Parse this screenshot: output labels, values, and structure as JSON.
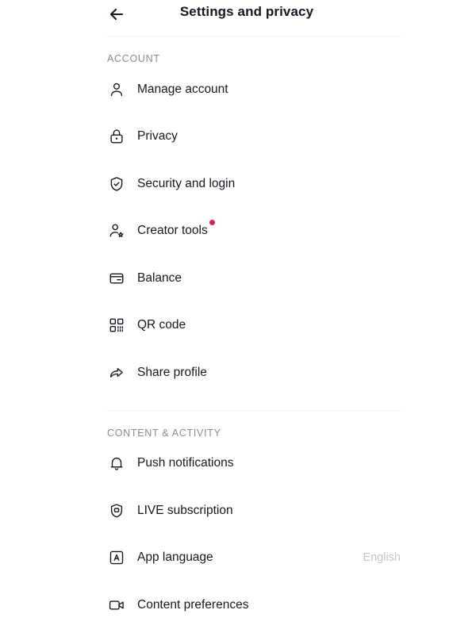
{
  "header": {
    "title": "Settings and privacy",
    "back_icon": "back-arrow-icon"
  },
  "sections": [
    {
      "label": "ACCOUNT",
      "items": [
        {
          "label": "Manage account",
          "icon": "person-icon",
          "value": "",
          "badge": false
        },
        {
          "label": "Privacy",
          "icon": "lock-icon",
          "value": "",
          "badge": false
        },
        {
          "label": "Security and login",
          "icon": "shield-check-icon",
          "value": "",
          "badge": false
        },
        {
          "label": "Creator tools",
          "icon": "person-star-icon",
          "value": "",
          "badge": true
        },
        {
          "label": "Balance",
          "icon": "wallet-icon",
          "value": "",
          "badge": false
        },
        {
          "label": "QR code",
          "icon": "qr-code-icon",
          "value": "",
          "badge": false
        },
        {
          "label": "Share profile",
          "icon": "share-arrow-icon",
          "value": "",
          "badge": false
        }
      ]
    },
    {
      "label": "CONTENT & ACTIVITY",
      "items": [
        {
          "label": "Push notifications",
          "icon": "bell-icon",
          "value": "",
          "badge": false
        },
        {
          "label": "LIVE subscription",
          "icon": "shield-live-icon",
          "value": "",
          "badge": false
        },
        {
          "label": "App language",
          "icon": "language-a-icon",
          "value": "English",
          "badge": false
        },
        {
          "label": "Content preferences",
          "icon": "video-camera-icon",
          "value": "",
          "badge": false
        }
      ]
    }
  ],
  "colors": {
    "badge": "#d9225d",
    "text": "#161823",
    "muted": "#8a8b91",
    "value": "#c5c6c9",
    "divider": "#f1f1f2"
  }
}
